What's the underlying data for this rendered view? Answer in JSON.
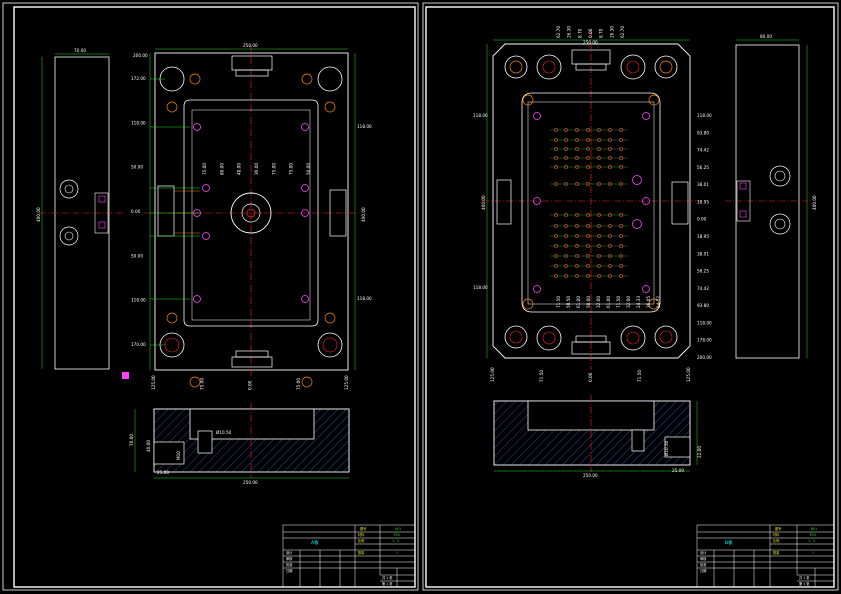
{
  "colors": {
    "background": "#000000",
    "border": "#ffffff",
    "outline": "#ffffff",
    "centerline": "#ff2222",
    "dimension": "#22dd22",
    "hatch": "#3a6ae0",
    "hole": "#ff3030",
    "hole_marker": "#ff44ff",
    "text": "#ffffff"
  },
  "left_sheet": {
    "top_view": {
      "width_label": "250.00",
      "height_label": "400.00",
      "left_dims": [
        "172.00",
        "118.00",
        "50.00",
        "0.00",
        "50.00",
        "118.00",
        "170.00"
      ],
      "right_dims": [
        "118.00",
        "118.00"
      ],
      "top_left_dim": "200.00",
      "bottom_dims": [
        "125.00",
        "75.00",
        "0.00",
        "75.00",
        "125.00"
      ],
      "inner_dims": [
        "75.00",
        "80.00",
        "48.00",
        "36.00",
        "75.00",
        "75.00",
        "50.00"
      ]
    },
    "side_view": {
      "width_label": "70.00",
      "height_label": "400.00"
    },
    "section_view": {
      "width_label": "250.00",
      "height_label": "70.00",
      "depth_label": "40.00",
      "pocket_label": "25.00",
      "hole_label": "Ø10.50",
      "thread_label": "M10"
    },
    "title_block": {
      "drawing_name": "A板",
      "code_label": "图号",
      "code_value": "A01",
      "material_label": "材料",
      "material_value": "P20",
      "scale_label": "比例",
      "scale_value": "1：2",
      "qty_label": "数量",
      "qty_value": "1",
      "rows": [
        "设计",
        "审核",
        "批准",
        "日期"
      ],
      "sheet_label": "共 1 张",
      "sheet_no": "第 1 张"
    }
  },
  "right_sheet": {
    "top_view": {
      "width_label": "250.00",
      "height_label": "400.00",
      "top_dims": [
        "62.70",
        "26.30",
        "8.70",
        "0.00",
        "8.70",
        "26.30",
        "62.70"
      ],
      "right_dims": [
        "118.00",
        "93.80",
        "74.42",
        "56.25",
        "38.01",
        "18.95",
        "0.00",
        "18.95",
        "38.01",
        "56.25",
        "74.42",
        "93.80",
        "118.00",
        "178.00",
        "200.00"
      ],
      "left_dims": [
        "118.00",
        "118.00"
      ],
      "bottom_dims": [
        "125.00",
        "71.50",
        "0.00",
        "71.50",
        "125.00"
      ],
      "inner_dims": [
        "71.50",
        "50.50",
        "61.00",
        "50.00",
        "32.00",
        "61.00",
        "71.50",
        "32.00",
        "24.33",
        "36.05",
        "14.72"
      ]
    },
    "side_view": {
      "width_label": "80.00",
      "height_label": "400.00"
    },
    "section_view": {
      "width_label": "250.00",
      "height_label": "80.00",
      "pocket_label": "25.00",
      "depth_label": "22.00",
      "hole_label": "Ø10.50"
    },
    "title_block": {
      "drawing_name": "B板",
      "code_label": "图号",
      "code_value": "B01",
      "material_label": "材料",
      "material_value": "P20",
      "scale_label": "比例",
      "scale_value": "1：2",
      "qty_label": "数量",
      "qty_value": "1",
      "rows": [
        "设计",
        "审核",
        "批准",
        "日期"
      ],
      "sheet_label": "共 1 张",
      "sheet_no": "第 1 张"
    }
  }
}
